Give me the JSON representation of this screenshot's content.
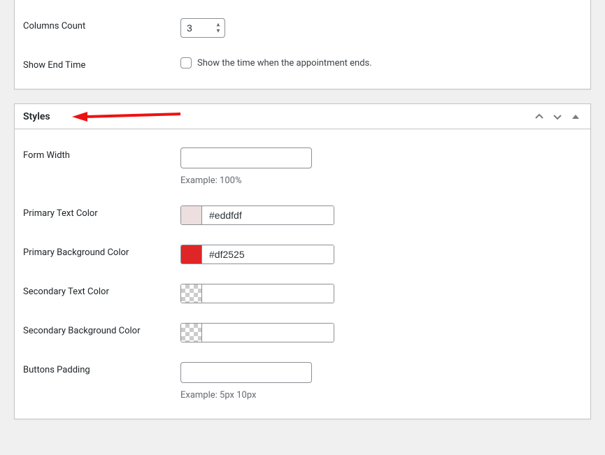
{
  "settings_top": {
    "columns_count": {
      "label": "Columns Count",
      "value": "3"
    },
    "show_end_time": {
      "label": "Show End Time",
      "checked": false,
      "description": "Show the time when the appointment ends."
    }
  },
  "styles_panel": {
    "title": "Styles",
    "form_width": {
      "label": "Form Width",
      "value": "",
      "hint": "Example: 100%"
    },
    "primary_text_color": {
      "label": "Primary Text Color",
      "value": "#eddfdf",
      "swatch": "#eddfdf"
    },
    "primary_bg_color": {
      "label": "Primary Background Color",
      "value": "#df2525",
      "swatch": "#df2525"
    },
    "secondary_text_color": {
      "label": "Secondary Text Color",
      "value": "",
      "swatch": "transparent"
    },
    "secondary_bg_color": {
      "label": "Secondary Background Color",
      "value": "",
      "swatch": "transparent"
    },
    "buttons_padding": {
      "label": "Buttons Padding",
      "value": "",
      "hint": "Example: 5px 10px"
    }
  }
}
